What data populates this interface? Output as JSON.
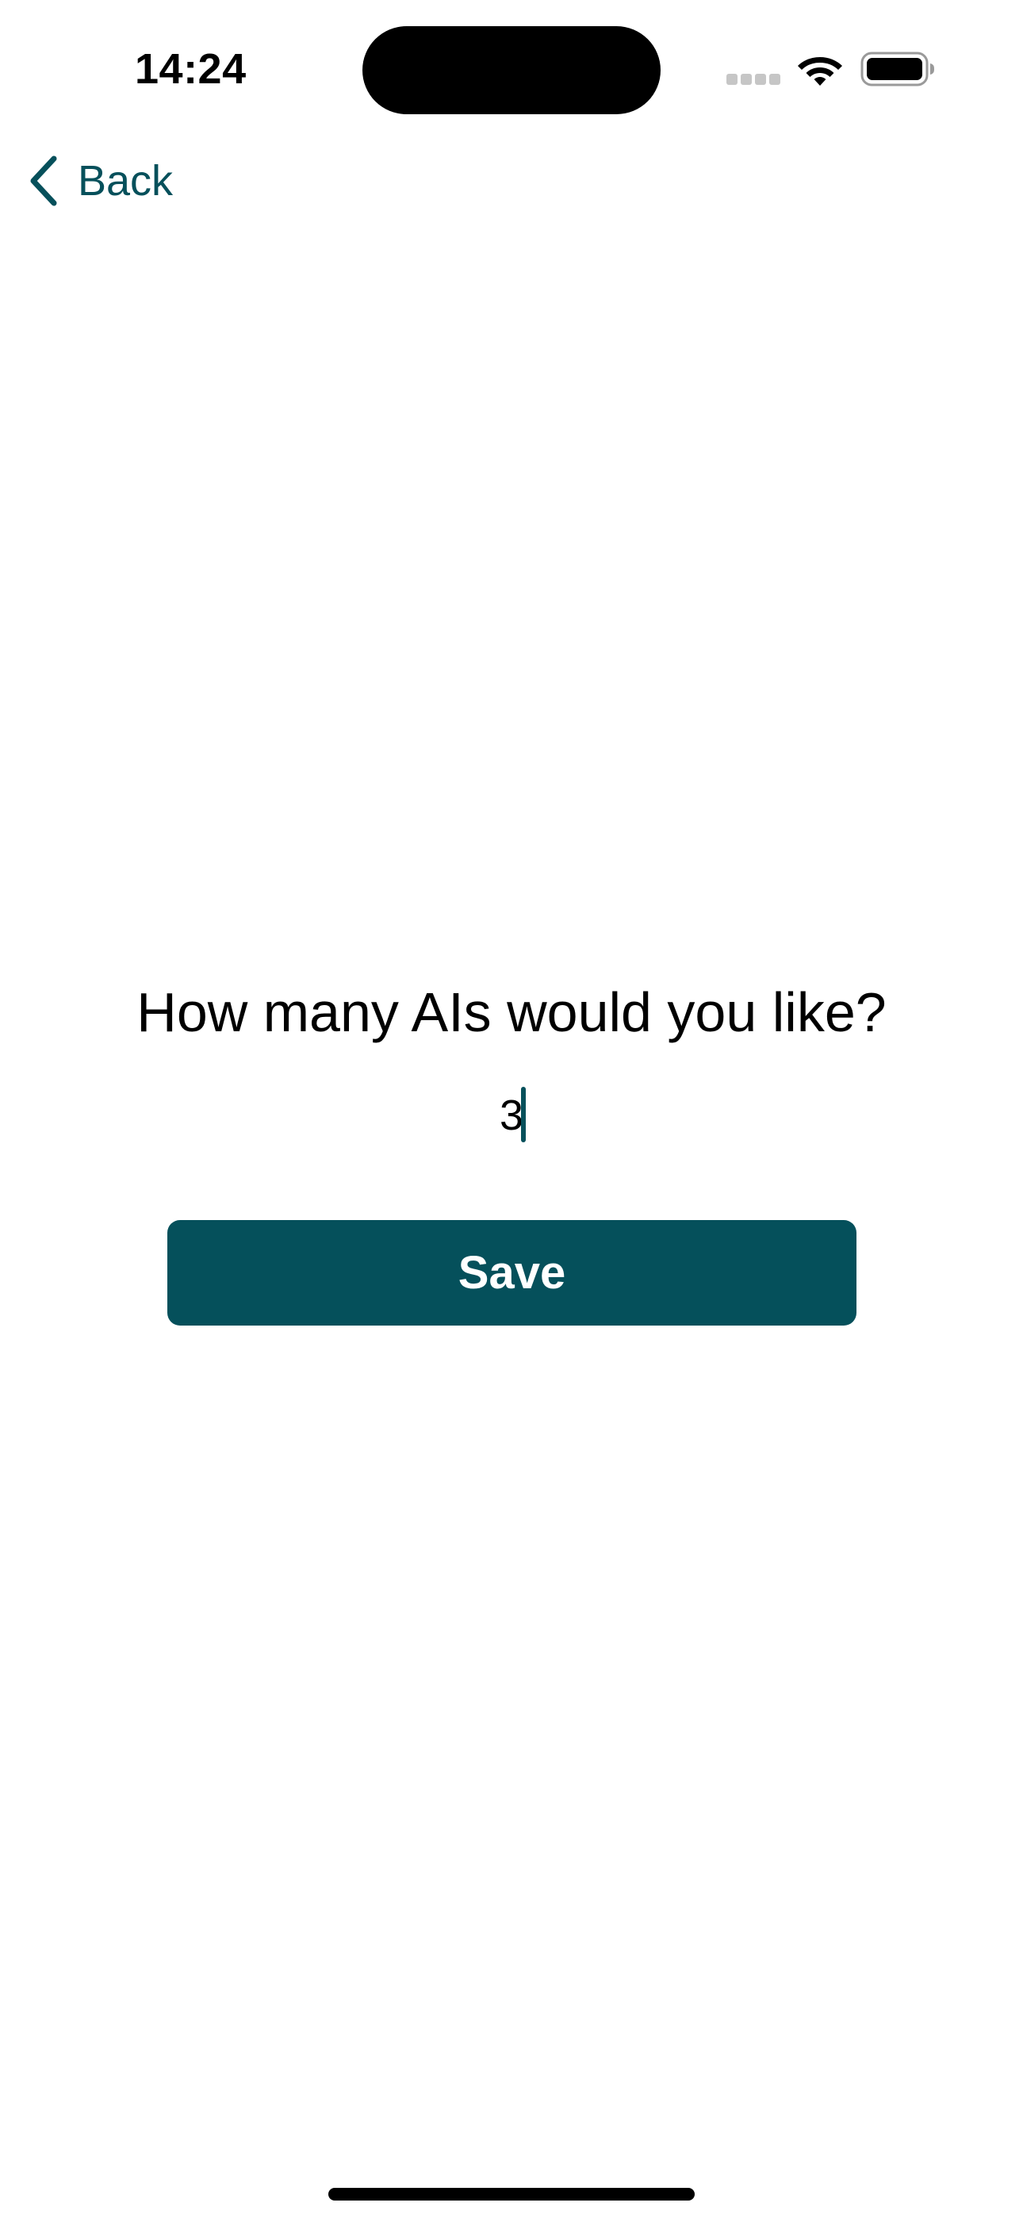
{
  "status_bar": {
    "time": "14:24",
    "icons": [
      "cellular-signal-icon",
      "wifi-icon",
      "battery-icon"
    ]
  },
  "navigation": {
    "back_label": "Back",
    "back_icon": "chevron-left-icon"
  },
  "form": {
    "question": "How many AIs would you like?",
    "count_value": "3",
    "save_label": "Save"
  },
  "colors": {
    "accent": "#05505b",
    "background": "#ffffff",
    "text": "#000000"
  }
}
